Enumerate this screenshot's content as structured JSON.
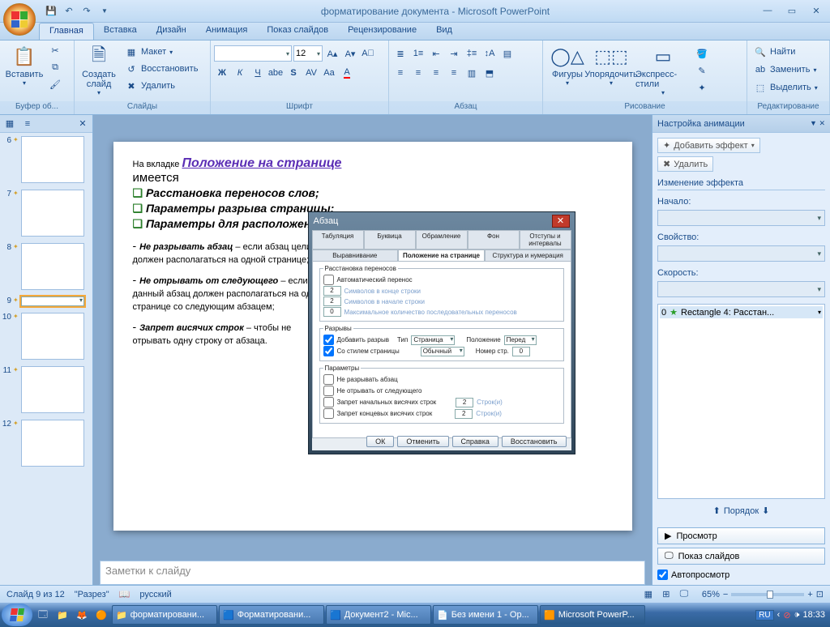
{
  "title": "форматирование документа - Microsoft PowerPoint",
  "tabs": [
    "Главная",
    "Вставка",
    "Дизайн",
    "Анимация",
    "Показ слайдов",
    "Рецензирование",
    "Вид"
  ],
  "activeTab": 0,
  "ribbon": {
    "clipboard": {
      "label": "Буфер об...",
      "paste": "Вставить"
    },
    "slides": {
      "label": "Слайды",
      "new": "Создать\nслайд",
      "layout": "Макет",
      "reset": "Восстановить",
      "delete": "Удалить"
    },
    "font": {
      "label": "Шрифт",
      "family": "",
      "size": "12"
    },
    "paragraph": {
      "label": "Абзац"
    },
    "drawing": {
      "label": "Рисование",
      "shapes": "Фигуры",
      "arrange": "Упорядочить",
      "quick": "Экспресс-стили"
    },
    "editing": {
      "label": "Редактирование",
      "find": "Найти",
      "replace": "Заменить",
      "select": "Выделить"
    }
  },
  "slide": {
    "line1_a": "На вкладке  ",
    "line1_b": "Положение на странице",
    "line2": "имеется",
    "b1": "Расстановка переносов слов;",
    "b2": "Параметры разрыва страницы;",
    "b3": "Параметры для расположения абзацев",
    "p1_b": "Не  разрывать абзац",
    "p1": " – если абзац целиком должен располагаться на одной странице;",
    "p2_b": "Не отрывать от следующего",
    "p2": " – если  данный абзац должен располагаться на одной странице со следующим абзацем;",
    "p3_b": "Запрет висячих строк",
    "p3": " – чтобы не отрывать одну строку от абзаца.",
    "tag": "0"
  },
  "dialog": {
    "title": "Абзац",
    "tabs": [
      "Табуляция",
      "Буквица",
      "Обрамление",
      "Фон",
      "Отступы и интервалы",
      "Выравнивание",
      "Положение на странице",
      "Структура и нумерация"
    ],
    "activeTab": 6,
    "hyph_legend": "Расстановка переносов",
    "hyph_auto": "Автоматический перенос",
    "hyph_end": "Символов в конце строки",
    "hyph_start": "Символов в начале строки",
    "hyph_max": "Максимальное количество последовательных переносов",
    "breaks_legend": "Разрывы",
    "add_break": "Добавить разрыв",
    "type": "Тип",
    "type_v": "Страница",
    "pos": "Положение",
    "pos_v": "Перед",
    "with_style": "Со стилем страницы",
    "style_v": "Обычный",
    "page_no": "Номер стр.",
    "page_no_v": "0",
    "params_legend": "Параметры",
    "no_split": "Не разрывать абзац",
    "keep_next": "Не отрывать от следующего",
    "widow1": "Запрет начальных висячих строк",
    "widow2": "Запрет концевых висячих строк",
    "lines": "Строк(и)",
    "ok": "ОК",
    "cancel": "Отменить",
    "help": "Справка",
    "restore": "Восстановить"
  },
  "notes_placeholder": "Заметки к слайду",
  "thumbs": [
    6,
    7,
    8,
    9,
    10,
    11,
    12
  ],
  "selectedThumb": 9,
  "taskpane": {
    "title": "Настройка анимации",
    "add": "Добавить эффект",
    "remove": "Удалить",
    "change_sec": "Изменение эффекта",
    "start": "Начало:",
    "prop": "Свойство:",
    "speed": "Скорость:",
    "item_n": "0",
    "item_t": "Rectangle 4:  Расстан...",
    "order": "Порядок",
    "preview": "Просмотр",
    "slideshow": "Показ слайдов",
    "autopreview": "Автопросмотр"
  },
  "status": {
    "slide": "Слайд 9 из 12",
    "theme": "\"Разрез\"",
    "lang": "русский",
    "zoom": "65%"
  },
  "taskbar": {
    "items": [
      {
        "icon": "folder",
        "label": "форматировани..."
      },
      {
        "icon": "word",
        "label": "Форматировани..."
      },
      {
        "icon": "word",
        "label": "Документ2 - Mic..."
      },
      {
        "icon": "oo",
        "label": "Без имени 1 - Op..."
      },
      {
        "icon": "ppt",
        "label": "Microsoft PowerP...",
        "active": true
      }
    ],
    "lang": "RU",
    "time": "18:33"
  }
}
